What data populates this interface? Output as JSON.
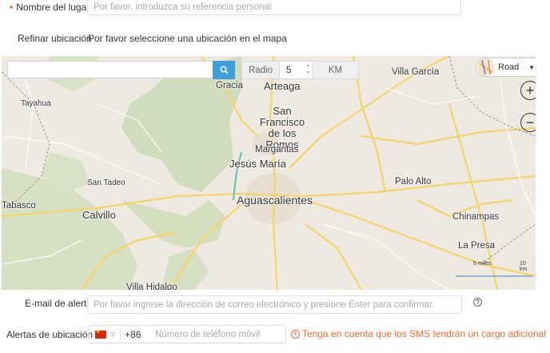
{
  "form": {
    "place_name": {
      "label": "Nombre del lugar",
      "placeholder": "Por favor, introduzca su referencia personal"
    },
    "refine": {
      "label": "Refinar ubicación",
      "hint": "Por favor seleccione una ubicación en el mapa"
    },
    "alert_email": {
      "label": "E-mail de alerta",
      "placeholder": "Por favor ingrese la dirección de correo electrónico y presione Enter para confirmar."
    },
    "location_alerts": {
      "label": "Alertas de ubicación",
      "country_code": "+86",
      "placeholder": "Número de teléfono móvil",
      "sms_note": "Tenga en cuenta que los SMS tendrán un cargo adicional"
    }
  },
  "map": {
    "search_value": "",
    "radius_label": "Radio",
    "radius_value": "5",
    "radius_unit": "KM",
    "map_type": "Road",
    "zoom_in": "+",
    "zoom_out": "−",
    "scale": {
      "miles": "5 miles",
      "km": "10 km"
    },
    "places": [
      {
        "name": "Gracia",
        "size": "mid"
      },
      {
        "name": "Arteaga",
        "size": "big"
      },
      {
        "name": "Villa García",
        "size": "mid"
      },
      {
        "name": "Tayahua",
        "size": "small"
      },
      {
        "name": "San Francisco de los Romos",
        "size": "big"
      },
      {
        "name": "Margaritas",
        "size": "mid"
      },
      {
        "name": "Jesús María",
        "size": "big"
      },
      {
        "name": "San Tadeo",
        "size": "small"
      },
      {
        "name": "Palo Alto",
        "size": "mid"
      },
      {
        "name": "Aguascalientes",
        "size": "xl"
      },
      {
        "name": "Tabasco",
        "size": "mid"
      },
      {
        "name": "Calvillo",
        "size": "big"
      },
      {
        "name": "Chinampas",
        "size": "mid"
      },
      {
        "name": "La Presa",
        "size": "mid"
      },
      {
        "name": "Villa Hidalgo",
        "size": "mid"
      }
    ]
  },
  "colors": {
    "accent": "#3f9fdb",
    "warning": "#f26a2e",
    "required": "#f04e23"
  }
}
